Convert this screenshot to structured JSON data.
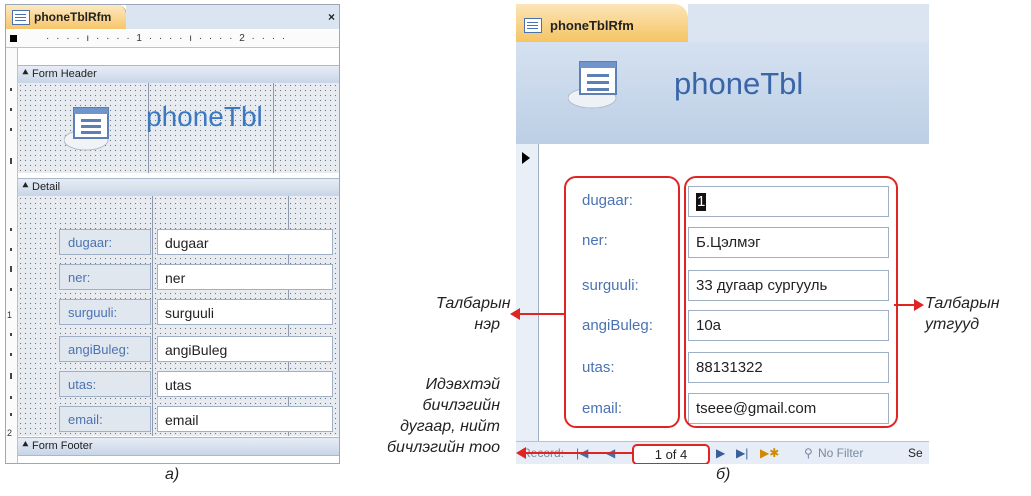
{
  "design_view": {
    "tab_title": "phoneTblRfm",
    "close_glyph": "×",
    "ruler_text": "· · · · ı · · · · 1 · · · · ı · · · · 2 · · · ·",
    "ruler_left_number": "1",
    "ruler_left_number_2": "2",
    "form_header_label": "Form Header",
    "header_title": "phoneTbl",
    "detail_label": "Detail",
    "form_footer_label": "Form Footer",
    "fields": [
      {
        "label": "dugaar:",
        "control": "dugaar"
      },
      {
        "label": "ner:",
        "control": "ner"
      },
      {
        "label": "surguuli:",
        "control": "surguuli"
      },
      {
        "label": "angiBuleg:",
        "control": "angiBuleg"
      },
      {
        "label": "utas:",
        "control": "utas"
      },
      {
        "label": "email:",
        "control": "email"
      }
    ]
  },
  "form_view": {
    "tab_title": "phoneTblRfm",
    "header_title": "phoneTbl",
    "cursor_value": "1",
    "fields": [
      {
        "label": "dugaar:",
        "value": ""
      },
      {
        "label": "ner:",
        "value": "Б.Цэлмэг"
      },
      {
        "label": "surguuli:",
        "value": "33 дугаар сургууль"
      },
      {
        "label": "angiBuleg:",
        "value": "10a"
      },
      {
        "label": "utas:",
        "value": "88131322"
      },
      {
        "label": "email:",
        "value": "tseee@gmail.com"
      }
    ],
    "navigation": {
      "record_label": "Record:",
      "first_icon": "first-record-icon",
      "counter": "1 of 4",
      "next_glyph": "▶",
      "last_glyph": "▶|",
      "new_glyph": "▶✱",
      "filter_label": "No Filter",
      "search_label": "Se"
    }
  },
  "annotations": {
    "field_names_line1": "Талбарын",
    "field_names_line2": "нэр",
    "field_values_line1": "Талбарын",
    "field_values_line2": "утгууд",
    "record_line1": "Идэвхтэй",
    "record_line2": "бичлэгийн",
    "record_line3": "дугаар, нийт",
    "record_line4": "бичлэгийн тоо"
  },
  "captions": {
    "a": "а)",
    "b": "б)"
  },
  "colors": {
    "accent_red": "#e02424",
    "label_blue": "#4a73b2",
    "title_blue": "#3a78c2"
  }
}
